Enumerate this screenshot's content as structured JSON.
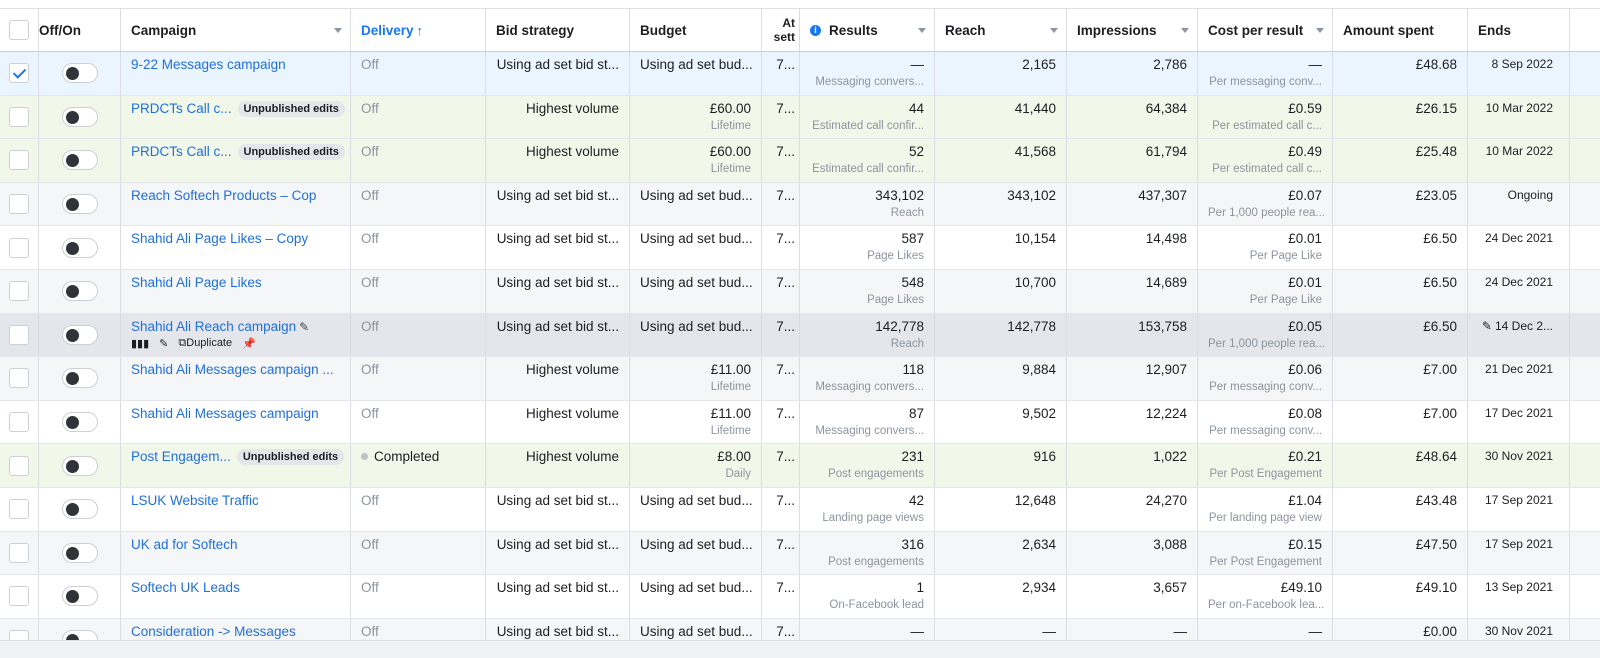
{
  "headers": {
    "offon": "Off/On",
    "campaign": "Campaign",
    "delivery": "Delivery",
    "delivery_arrow": "↑",
    "bid_strategy": "Bid strategy",
    "budget": "Budget",
    "attribution": "At sett",
    "results": "Results",
    "reach": "Reach",
    "impressions": "Impressions",
    "cost_per_result": "Cost per result",
    "amount_spent": "Amount spent",
    "ends": "Ends"
  },
  "colors": {
    "accent": "#1877f2",
    "link": "#216fdb",
    "selected_row": "#ebf5ff",
    "edited_row": "#f1f8ea"
  },
  "hover_actions": {
    "duplicate": "Duplicate"
  },
  "rows": [
    {
      "checked": true,
      "campaign": "9-22 Messages campaign",
      "badge": "",
      "delivery": "Off",
      "bid": "Using ad set bid st...",
      "budget": "Using ad set bud...",
      "budget_sub": "",
      "attr": "7...",
      "results": "—",
      "results_sub": "Messaging convers...",
      "reach": "2,165",
      "impressions": "2,786",
      "cpr": "—",
      "cpr_sub": "Per messaging conv...",
      "spent": "£48.68",
      "ends": "8 Sep 2022"
    },
    {
      "checked": false,
      "campaign": "PRDCTs Call c...",
      "badge": "Unpublished edits",
      "delivery": "Off",
      "bid": "Highest volume",
      "budget": "£60.00",
      "budget_sub": "Lifetime",
      "attr": "7...",
      "results": "44",
      "results_sub": "Estimated call confir...",
      "reach": "41,440",
      "impressions": "64,384",
      "cpr": "£0.59",
      "cpr_sub": "Per estimated call c...",
      "spent": "£26.15",
      "ends": "10 Mar 2022"
    },
    {
      "checked": false,
      "campaign": "PRDCTs Call c...",
      "badge": "Unpublished edits",
      "delivery": "Off",
      "bid": "Highest volume",
      "budget": "£60.00",
      "budget_sub": "Lifetime",
      "attr": "7...",
      "results": "52",
      "results_sub": "Estimated call confir...",
      "reach": "41,568",
      "impressions": "61,794",
      "cpr": "£0.49",
      "cpr_sub": "Per estimated call c...",
      "spent": "£25.48",
      "ends": "10 Mar 2022"
    },
    {
      "checked": false,
      "campaign": "Reach Softech Products – Cop",
      "badge": "",
      "delivery": "Off",
      "bid": "Using ad set bid st...",
      "budget": "Using ad set bud...",
      "budget_sub": "",
      "attr": "7...",
      "results": "343,102",
      "results_sub": "Reach",
      "reach": "343,102",
      "impressions": "437,307",
      "cpr": "£0.07",
      "cpr_sub": "Per 1,000 people rea...",
      "spent": "£23.05",
      "ends": "Ongoing"
    },
    {
      "checked": false,
      "campaign": "Shahid Ali Page Likes – Copy",
      "badge": "",
      "delivery": "Off",
      "bid": "Using ad set bid st...",
      "budget": "Using ad set bud...",
      "budget_sub": "",
      "attr": "7...",
      "results": "587",
      "results_sub": "Page Likes",
      "reach": "10,154",
      "impressions": "14,498",
      "cpr": "£0.01",
      "cpr_sub": "Per Page Like",
      "spent": "£6.50",
      "ends": "24 Dec 2021"
    },
    {
      "checked": false,
      "campaign": "Shahid Ali Page Likes",
      "badge": "",
      "delivery": "Off",
      "bid": "Using ad set bid st...",
      "budget": "Using ad set bud...",
      "budget_sub": "",
      "attr": "7...",
      "results": "548",
      "results_sub": "Page Likes",
      "reach": "10,700",
      "impressions": "14,689",
      "cpr": "£0.01",
      "cpr_sub": "Per Page Like",
      "spent": "£6.50",
      "ends": "24 Dec 2021"
    },
    {
      "checked": false,
      "campaign": "Shahid Ali Reach campaign",
      "badge": "",
      "delivery": "Off",
      "bid": "Using ad set bid st...",
      "budget": "Using ad set bud...",
      "budget_sub": "",
      "attr": "7...",
      "results": "142,778",
      "results_sub": "Reach",
      "reach": "142,778",
      "impressions": "153,758",
      "cpr": "£0.05",
      "cpr_sub": "Per 1,000 people rea...",
      "spent": "£6.50",
      "ends": "14 Dec 2..."
    },
    {
      "checked": false,
      "campaign": "Shahid Ali Messages campaign ...",
      "badge": "",
      "delivery": "Off",
      "bid": "Highest volume",
      "budget": "£11.00",
      "budget_sub": "Lifetime",
      "attr": "7...",
      "results": "118",
      "results_sub": "Messaging convers...",
      "reach": "9,884",
      "impressions": "12,907",
      "cpr": "£0.06",
      "cpr_sub": "Per messaging conv...",
      "spent": "£7.00",
      "ends": "21 Dec 2021"
    },
    {
      "checked": false,
      "campaign": "Shahid Ali Messages campaign",
      "badge": "",
      "delivery": "Off",
      "bid": "Highest volume",
      "budget": "£11.00",
      "budget_sub": "Lifetime",
      "attr": "7...",
      "results": "87",
      "results_sub": "Messaging convers...",
      "reach": "9,502",
      "impressions": "12,224",
      "cpr": "£0.08",
      "cpr_sub": "Per messaging conv...",
      "spent": "£7.00",
      "ends": "17 Dec 2021"
    },
    {
      "checked": false,
      "campaign": "Post Engagem...",
      "badge": "Unpublished edits",
      "delivery": "Completed",
      "bid": "Highest volume",
      "budget": "£8.00",
      "budget_sub": "Daily",
      "attr": "7...",
      "results": "231",
      "results_sub": "Post engagements",
      "reach": "916",
      "impressions": "1,022",
      "cpr": "£0.21",
      "cpr_sub": "Per Post Engagement",
      "spent": "£48.64",
      "ends": "30 Nov 2021"
    },
    {
      "checked": false,
      "campaign": "LSUK Website Traffic",
      "badge": "",
      "delivery": "Off",
      "bid": "Using ad set bid st...",
      "budget": "Using ad set bud...",
      "budget_sub": "",
      "attr": "7...",
      "results": "42",
      "results_sub": "Landing page views",
      "reach": "12,648",
      "impressions": "24,270",
      "cpr": "£1.04",
      "cpr_sub": "Per landing page view",
      "spent": "£43.48",
      "ends": "17 Sep 2021"
    },
    {
      "checked": false,
      "campaign": "UK ad for Softech",
      "badge": "",
      "delivery": "Off",
      "bid": "Using ad set bid st...",
      "budget": "Using ad set bud...",
      "budget_sub": "",
      "attr": "7...",
      "results": "316",
      "results_sub": "Post engagements",
      "reach": "2,634",
      "impressions": "3,088",
      "cpr": "£0.15",
      "cpr_sub": "Per Post Engagement",
      "spent": "£47.50",
      "ends": "17 Sep 2021"
    },
    {
      "checked": false,
      "campaign": "Softech UK Leads",
      "badge": "",
      "delivery": "Off",
      "bid": "Using ad set bid st...",
      "budget": "Using ad set bud...",
      "budget_sub": "",
      "attr": "7...",
      "results": "1",
      "results_sub": "On-Facebook lead",
      "reach": "2,934",
      "impressions": "3,657",
      "cpr": "£49.10",
      "cpr_sub": "Per on-Facebook lea...",
      "spent": "£49.10",
      "ends": "13 Sep 2021"
    },
    {
      "checked": false,
      "campaign": "Consideration -> Messages",
      "badge": "",
      "delivery": "Off",
      "bid": "Using ad set bid st...",
      "budget": "Using ad set bud...",
      "budget_sub": "",
      "attr": "7...",
      "results": "—",
      "results_sub": "",
      "reach": "—",
      "impressions": "—",
      "cpr": "—",
      "cpr_sub": "",
      "spent": "£0.00",
      "ends": "30 Nov 2021"
    }
  ]
}
